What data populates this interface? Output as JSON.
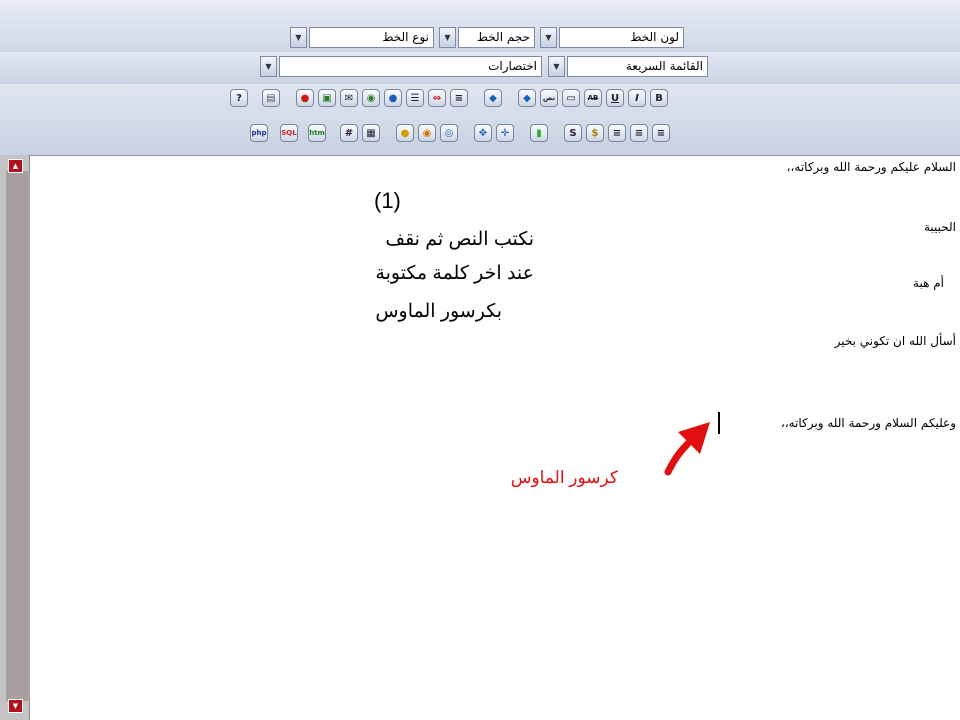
{
  "toolbar": {
    "font_color_label": "لون الخط",
    "font_size_label": "حجم الخط",
    "font_type_label": "نوع الخط",
    "quick_list_label": "القائمة السريعة",
    "shortcuts_label": "اختصارات",
    "icon_labels": {
      "help": "?",
      "bold": "B",
      "italic": "I",
      "underline": "U",
      "strike": "AB",
      "text": "نص",
      "php": "php",
      "sql": "SQL",
      "htm": "htm",
      "hash": "#",
      "dollar": "$",
      "s": "S"
    }
  },
  "editor": {
    "greeting": "السلام عليكم ورحمة الله وبركاته،،",
    "dear": "الحبيبة",
    "name": "أم هبة",
    "wish": "أسأل الله ان تكوني بخير",
    "reply": "وعليكم السلام ورحمة الله وبركاته،،",
    "step_number": "(1)",
    "instruction_1": "نكتب النص ثم نقف",
    "instruction_2": "عند اخر كلمة مكتوبة",
    "instruction_3": "بكرسور الماوس",
    "cursor_label": "كرسور الماوس"
  },
  "colors": {
    "annotation": "#e01010",
    "scroll_button": "#b01020"
  }
}
